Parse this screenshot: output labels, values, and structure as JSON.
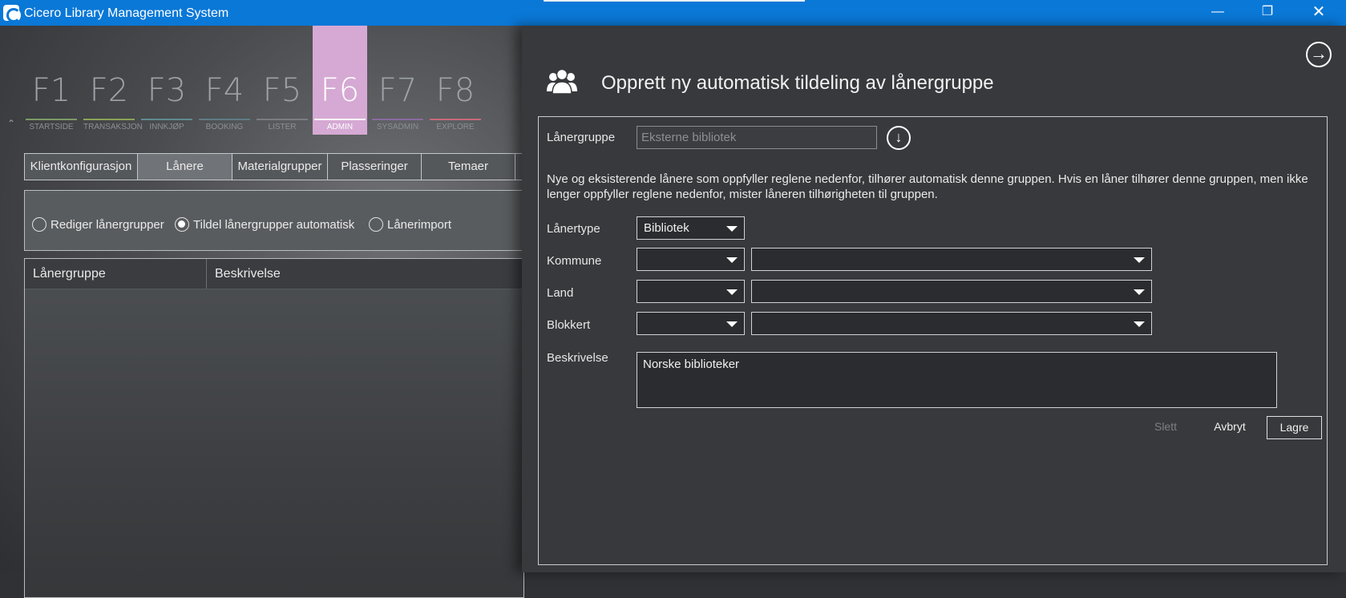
{
  "window": {
    "title": "Cicero Library Management System",
    "minimize_icon": "minimize-icon",
    "maximize_icon": "restore-icon",
    "close_icon": "close-icon"
  },
  "fkeys": [
    {
      "key": "F1",
      "label": "STARTSIDE"
    },
    {
      "key": "F2",
      "label": "TRANSAKSJON"
    },
    {
      "key": "F3",
      "label": "INNKJØP"
    },
    {
      "key": "F4",
      "label": "BOOKING"
    },
    {
      "key": "F5",
      "label": "LISTER"
    },
    {
      "key": "F6",
      "label": "ADMIN",
      "active": true
    },
    {
      "key": "F7",
      "label": "SYSADMIN"
    },
    {
      "key": "F8",
      "label": "EXPLORE"
    }
  ],
  "subtabs": [
    {
      "label": "Klientkonfigurasjon"
    },
    {
      "label": "Lånere",
      "selected": true
    },
    {
      "label": "Materialgrupper"
    },
    {
      "label": "Plasseringer"
    },
    {
      "label": "Temaer"
    }
  ],
  "radios": [
    {
      "label": "Rediger lånergrupper",
      "checked": false
    },
    {
      "label": "Tildel lånergrupper automatisk",
      "checked": true
    },
    {
      "label": "Lånerimport",
      "checked": false
    }
  ],
  "grid": {
    "columns": [
      "Lånergruppe",
      "Beskrivelse"
    ]
  },
  "panel": {
    "title": "Opprett ny automatisk tildeling av lånergruppe",
    "group_label": "Lånergruppe",
    "group_placeholder": "Eksterne bibliotek",
    "info_text": "Nye og eksisterende lånere som oppfyller reglene nedenfor, tilhører automatisk denne gruppen. Hvis en låner tilhører denne gruppen, men ikke lenger oppfyller reglene nedenfor, mister låneren tilhørigheten til gruppen.",
    "lanertype_label": "Lånertype",
    "lanertype_value": "Bibliotek",
    "kommune_label": "Kommune",
    "land_label": "Land",
    "blokkert_label": "Blokkert",
    "beskrivelse_label": "Beskrivelse",
    "beskrivelse_value": "Norske biblioteker",
    "delete_label": "Slett",
    "cancel_label": "Avbryt",
    "save_label": "Lagre"
  },
  "colors": {
    "titlebar": "#0a78d7",
    "active_tab": "#d5a9d3"
  }
}
